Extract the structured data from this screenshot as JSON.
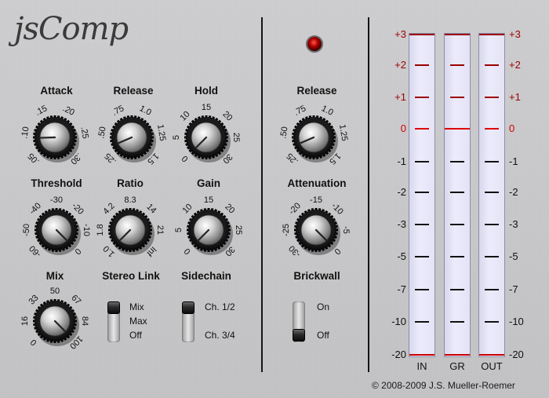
{
  "app": {
    "logo_text": "jsComp",
    "copyright": "© 2008-2009 J.S. Mueller-Roemer"
  },
  "knobs": [
    {
      "id": "attack",
      "label": "Attack",
      "scale": [
        ".05",
        ".10",
        ".15",
        ".20",
        ".25",
        ".30"
      ],
      "value_pct": 0.16
    },
    {
      "id": "release",
      "label": "Release",
      "scale": [
        ".25",
        ".50",
        ".75",
        "1.0",
        "1.25",
        "1.5"
      ],
      "value_pct": 0.08
    },
    {
      "id": "hold",
      "label": "Hold",
      "scale": [
        "0",
        "5",
        "10",
        "15",
        "20",
        "25",
        "30"
      ],
      "value_pct": 0.0
    },
    {
      "id": "threshold",
      "label": "Threshold",
      "scale": [
        "-60",
        "-50",
        "-40",
        "-30",
        "-20",
        "-10",
        "0"
      ],
      "value_pct": 1.0
    },
    {
      "id": "ratio",
      "label": "Ratio",
      "scale": [
        "1.0",
        "1.8",
        "4.2",
        "8.3",
        "14",
        "21",
        "Inf"
      ],
      "value_pct": 0.0
    },
    {
      "id": "gain",
      "label": "Gain",
      "scale": [
        "0",
        "5",
        "10",
        "15",
        "20",
        "25",
        "30"
      ],
      "value_pct": 0.0
    },
    {
      "id": "mix",
      "label": "Mix",
      "scale": [
        "0",
        "16",
        "33",
        "50",
        "67",
        "84",
        "100"
      ],
      "value_pct": 1.0
    },
    {
      "id": "brickwall-release",
      "label": "Release",
      "scale": [
        ".25",
        ".50",
        ".75",
        "1.0",
        "1.25",
        "1.5"
      ],
      "value_pct": 0.08
    },
    {
      "id": "attenuation",
      "label": "Attenuation",
      "scale": [
        "-30",
        "-25",
        "-20",
        "-15",
        "-10",
        "-5",
        "0"
      ],
      "value_pct": 1.0
    }
  ],
  "stereo_link": {
    "label": "Stereo Link",
    "options": [
      "Mix",
      "Max",
      "Off"
    ],
    "selected": "Mix"
  },
  "sidechain": {
    "label": "Sidechain",
    "options": [
      "Ch. 1/2",
      "Ch. 3/4"
    ],
    "selected": "Ch. 1/2"
  },
  "brickwall": {
    "label": "Brickwall",
    "options": [
      "On",
      "Off"
    ],
    "selected": "Off"
  },
  "meters": {
    "scale": [
      "+3",
      "+2",
      "+1",
      "0",
      "-1",
      "-2",
      "-3",
      "-5",
      "-7",
      "-10",
      "-20"
    ],
    "channels": [
      {
        "id": "in",
        "label": "IN"
      },
      {
        "id": "gr",
        "label": "GR"
      },
      {
        "id": "out",
        "label": "OUT"
      }
    ],
    "colors": {
      "positive": "#9b0000",
      "zero": "#cc0000",
      "negative": "#111111"
    }
  }
}
